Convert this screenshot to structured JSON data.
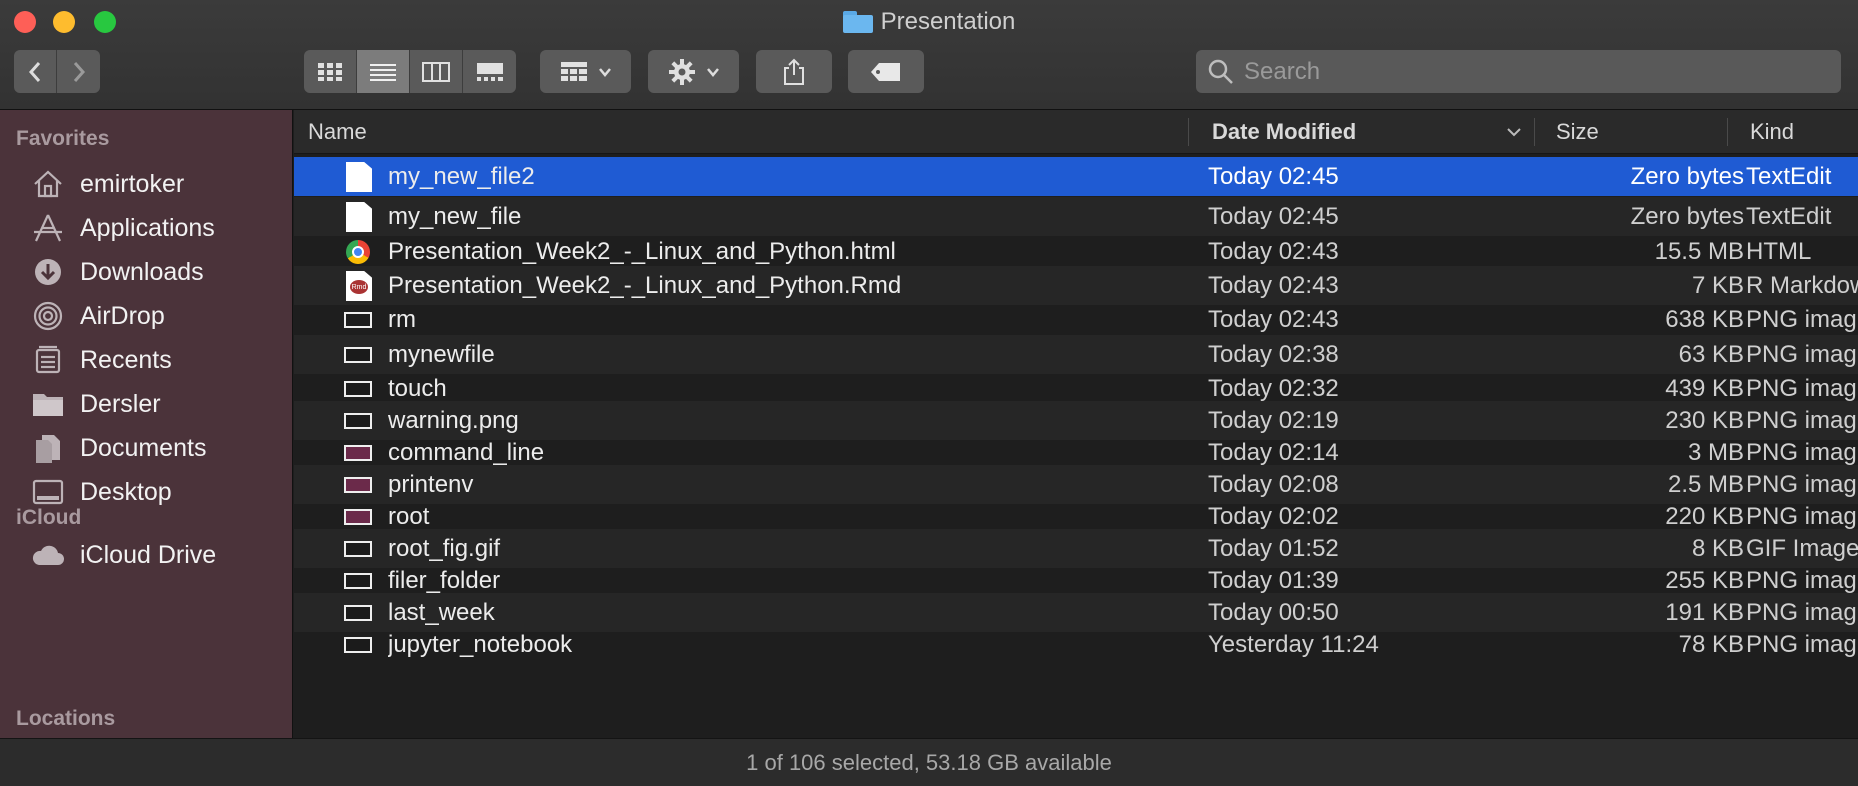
{
  "window": {
    "title": "Presentation"
  },
  "toolbar": {
    "back_icon": "chevron-left-icon",
    "forward_icon": "chevron-right-icon",
    "view_modes": [
      "icon-view",
      "list-view",
      "column-view",
      "gallery-view"
    ],
    "active_view": "list-view",
    "group_icon": "group-icon",
    "action_icon": "gear-icon",
    "share_icon": "share-icon",
    "tag_icon": "tag-icon",
    "search_placeholder": "Search"
  },
  "sidebar": {
    "favorites_label": "Favorites",
    "favorites": [
      {
        "label": "emirtoker",
        "icon": "home-icon"
      },
      {
        "label": "Applications",
        "icon": "applications-icon"
      },
      {
        "label": "Downloads",
        "icon": "downloads-icon"
      },
      {
        "label": "AirDrop",
        "icon": "airdrop-icon"
      },
      {
        "label": "Recents",
        "icon": "recents-icon"
      },
      {
        "label": "Dersler",
        "icon": "folder-icon"
      },
      {
        "label": "Documents",
        "icon": "documents-icon"
      },
      {
        "label": "Desktop",
        "icon": "desktop-icon"
      }
    ],
    "icloud_label": "iCloud",
    "icloud": [
      {
        "label": "iCloud Drive",
        "icon": "cloud-icon"
      }
    ],
    "locations_label": "Locations"
  },
  "columns": {
    "name": "Name",
    "date": "Date Modified",
    "size": "Size",
    "kind": "Kind"
  },
  "files": [
    {
      "name": "my_new_file2",
      "date": "Today 02:45",
      "size": "Zero bytes",
      "kind": "TextEdit",
      "icon": "document-icon",
      "selected": true
    },
    {
      "name": "my_new_file",
      "date": "Today 02:45",
      "size": "Zero bytes",
      "kind": "TextEdit",
      "icon": "document-icon"
    },
    {
      "name": "Presentation_Week2_-_Linux_and_Python.html",
      "date": "Today 02:43",
      "size": "15.5 MB",
      "kind": "HTML",
      "icon": "chrome-icon"
    },
    {
      "name": "Presentation_Week2_-_Linux_and_Python.Rmd",
      "date": "Today 02:43",
      "size": "7 KB",
      "kind": "R Markdow",
      "icon": "rmd-icon"
    },
    {
      "name": "rm",
      "date": "Today 02:43",
      "size": "638 KB",
      "kind": "PNG imag",
      "icon": "image-icon"
    },
    {
      "name": "mynewfile",
      "date": "Today 02:38",
      "size": "63 KB",
      "kind": "PNG imag",
      "icon": "image-icon"
    },
    {
      "name": "touch",
      "date": "Today 02:32",
      "size": "439 KB",
      "kind": "PNG imag",
      "icon": "image-icon"
    },
    {
      "name": "warning.png",
      "date": "Today 02:19",
      "size": "230 KB",
      "kind": "PNG imag",
      "icon": "image-icon"
    },
    {
      "name": "command_line",
      "date": "Today 02:14",
      "size": "3 MB",
      "kind": "PNG imag",
      "icon": "image-icon-pink"
    },
    {
      "name": "printenv",
      "date": "Today 02:08",
      "size": "2.5 MB",
      "kind": "PNG imag",
      "icon": "image-icon-pink"
    },
    {
      "name": "root",
      "date": "Today 02:02",
      "size": "220 KB",
      "kind": "PNG imag",
      "icon": "image-icon-pink"
    },
    {
      "name": "root_fig.gif",
      "date": "Today 01:52",
      "size": "8 KB",
      "kind": "GIF Image",
      "icon": "image-icon"
    },
    {
      "name": "filer_folder",
      "date": "Today 01:39",
      "size": "255 KB",
      "kind": "PNG imag",
      "icon": "image-icon"
    },
    {
      "name": "last_week",
      "date": "Today 00:50",
      "size": "191 KB",
      "kind": "PNG imag",
      "icon": "image-icon"
    },
    {
      "name": "jupyter_notebook",
      "date": "Yesterday 11:24",
      "size": "78 KB",
      "kind": "PNG imag",
      "icon": "image-icon"
    }
  ],
  "status": "1 of 106 selected, 53.18 GB available"
}
